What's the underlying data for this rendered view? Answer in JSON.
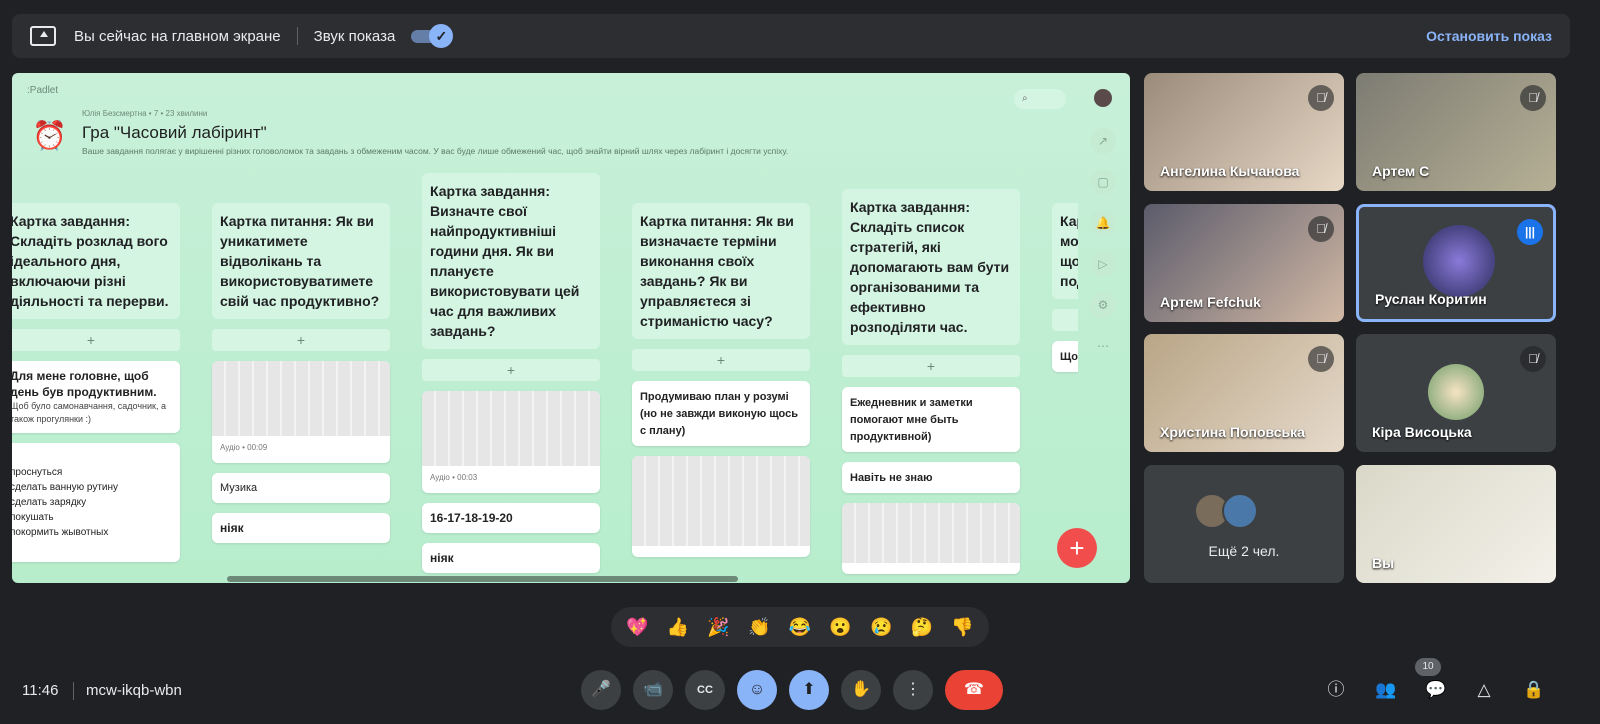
{
  "banner": {
    "main_screen_text": "Вы сейчас на главном экране",
    "sound_label": "Звук показа",
    "stop_label": "Остановить показ"
  },
  "padlet": {
    "logo": "Padlet",
    "author": "Юлія Безсмертна • 7 • 23 хвилини",
    "title": "Гра \"Часовий лабіринт\"",
    "description": "Ваше завдання полягає у вирішенні різних головоломок та завдань з обмеженим часом. У вас буде лише обмежений час, щоб знайти вірний шлях через лабіринт і досягти успіху.",
    "columns": [
      {
        "head": "Картка завдання: Складіть розклад вого ідеального дня, включаючи різні діяльності та перерви.",
        "cards": [
          {
            "bold": "Для мене головне, щоб день був продуктивним.",
            "small": "Щоб було самонавчання, садочник, а також прогулянки :)"
          },
          {
            "text": "проснуться\nсделать ванную рутину\nсделать зарядку\nпокушать\nпокормить жывотных"
          }
        ]
      },
      {
        "head": "Картка питання: Як ви уникатимете відволікань та використовуватимете свій час продуктивно?",
        "cards": [
          {
            "media": true,
            "meta": "Аудіо • 00:09"
          },
          {
            "text": "Музика"
          },
          {
            "bold": "ніяк"
          }
        ]
      },
      {
        "head": "Картка завдання: Визначте свої найпродуктивніші години дня. Як ви плануєте використовувати цей час для важливих завдань?",
        "cards": [
          {
            "media": true,
            "meta": "Аудіо • 00:03"
          },
          {
            "bold": "16-17-18-19-20"
          },
          {
            "bold": "ніяк"
          }
        ]
      },
      {
        "head": "Картка питання: Як ви визначаєте терміни виконання своїх завдань? Як ви управляєтеся зі стриманістю часу?",
        "cards": [
          {
            "bold": "Продумиваю план у розумі (но не завжди виконую щось с плану)"
          },
          {
            "media": true,
            "meta": ""
          }
        ]
      },
      {
        "head": "Картка завдання: Складіть список стратегій, які допомагають вам бути організованими та ефективно розподіляти час.",
        "cards": [
          {
            "bold": "Ежедневник и заметки помогают мне быть продуктивной)"
          },
          {
            "bold": "Навіть не знаю"
          },
          {
            "media": true,
            "meta": ""
          }
        ]
      },
      {
        "head": "Картка питання: Які можливості у вас є, щоб спланувати час на подальше?",
        "cards": [
          {
            "bold": "Щось або планувати"
          }
        ]
      }
    ],
    "search_icon": "search-icon"
  },
  "participants": [
    {
      "name": "Ангелина Кычанова",
      "muted": true
    },
    {
      "name": "Артем С",
      "muted": true
    },
    {
      "name": "Артем Fefchuk",
      "muted": true
    },
    {
      "name": "Руслан Коритин",
      "muted": false,
      "speaking": true
    },
    {
      "name": "Христина Поповська",
      "muted": true
    },
    {
      "name": "Кіра Висоцька",
      "muted": true
    },
    {
      "more": "Ещё 2 чел."
    },
    {
      "name": "Вы"
    }
  ],
  "reactions": [
    "💖",
    "👍",
    "🎉",
    "👏",
    "😂",
    "😮",
    "😢",
    "🤔",
    "👎"
  ],
  "meeting": {
    "time": "11:46",
    "code": "mcw-ikqb-wbn",
    "participant_count": "10"
  },
  "colors": {
    "accent": "#8ab4f8",
    "end_call": "#ea4335",
    "padlet_bg": "#c8f0d9"
  }
}
